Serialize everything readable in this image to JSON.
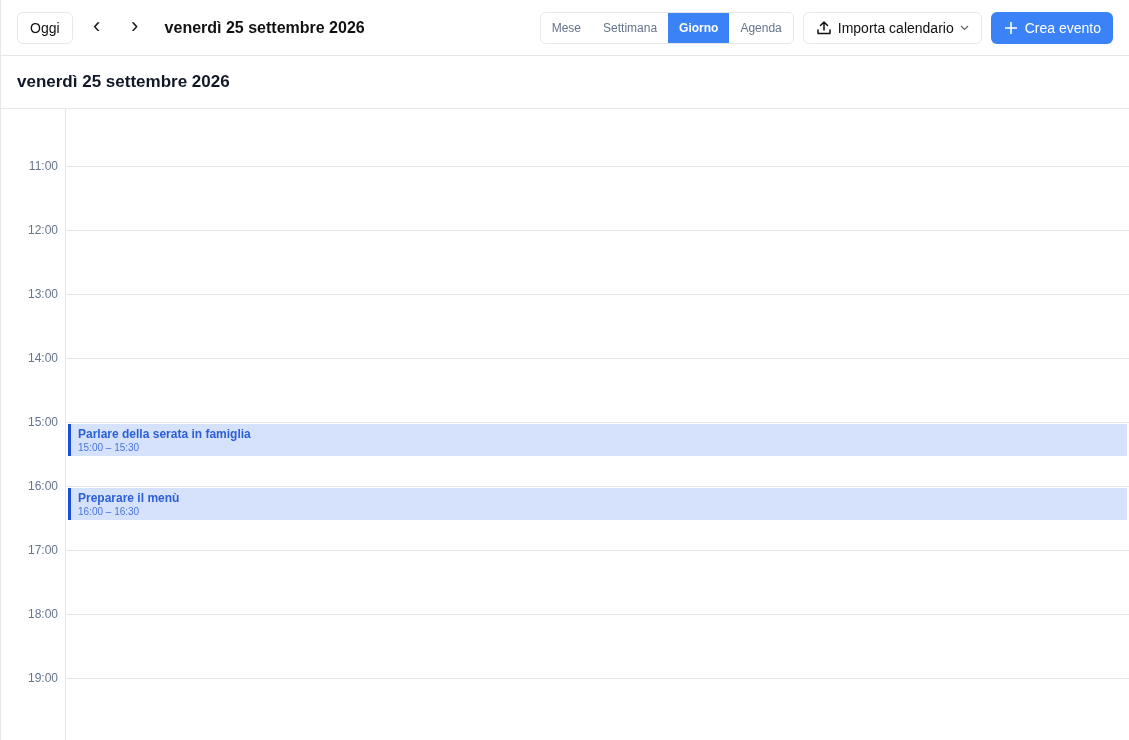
{
  "toolbar": {
    "today_button": "Oggi",
    "prev_button": "‹",
    "next_button": "›",
    "current_date": "venerdì 25 settembre 2026",
    "views": [
      {
        "label": "Mese",
        "selected": false
      },
      {
        "label": "Settimana",
        "selected": false
      },
      {
        "label": "Giorno",
        "selected": true
      },
      {
        "label": "Agenda",
        "selected": false
      }
    ],
    "import_button": "Importa calendario",
    "create_button": "Crea evento"
  },
  "day_header": "venerdì 25 settembre 2026",
  "slots": [
    {
      "time": "11:00"
    },
    {
      "time": "12:00"
    },
    {
      "time": "13:00"
    },
    {
      "time": "14:00"
    },
    {
      "time": "15:00",
      "events": [
        {
          "title": "Parlare della serata in famiglia",
          "time": "15:00 – 15:30"
        }
      ]
    },
    {
      "time": "16:00",
      "events": [
        {
          "title": "Preparare il menù",
          "time": "16:00 – 16:30"
        }
      ]
    },
    {
      "time": "17:00"
    },
    {
      "time": "18:00"
    },
    {
      "time": "19:00"
    }
  ]
}
